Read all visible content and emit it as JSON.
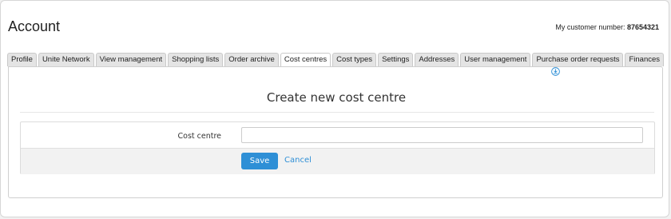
{
  "header": {
    "title": "Account",
    "customer_label": "My customer number: ",
    "customer_number": "87654321"
  },
  "tabs": [
    {
      "label": "Profile"
    },
    {
      "label": "Unite Network"
    },
    {
      "label": "View management"
    },
    {
      "label": "Shopping lists"
    },
    {
      "label": "Order archive"
    },
    {
      "label": "Cost centres",
      "active": true
    },
    {
      "label": "Cost types"
    },
    {
      "label": "Settings"
    },
    {
      "label": "Addresses"
    },
    {
      "label": "User management"
    },
    {
      "label": "Purchase order requests"
    },
    {
      "label": "Finances"
    }
  ],
  "tab_icon": "download-circle-icon",
  "form": {
    "heading": "Create new cost centre",
    "field_label": "Cost centre",
    "field_value": "",
    "save_label": "Save",
    "cancel_label": "Cancel"
  },
  "colors": {
    "accent": "#2e8fd6",
    "tab_bg": "#e4e4e4",
    "footer_bg": "#f2f2f2"
  }
}
